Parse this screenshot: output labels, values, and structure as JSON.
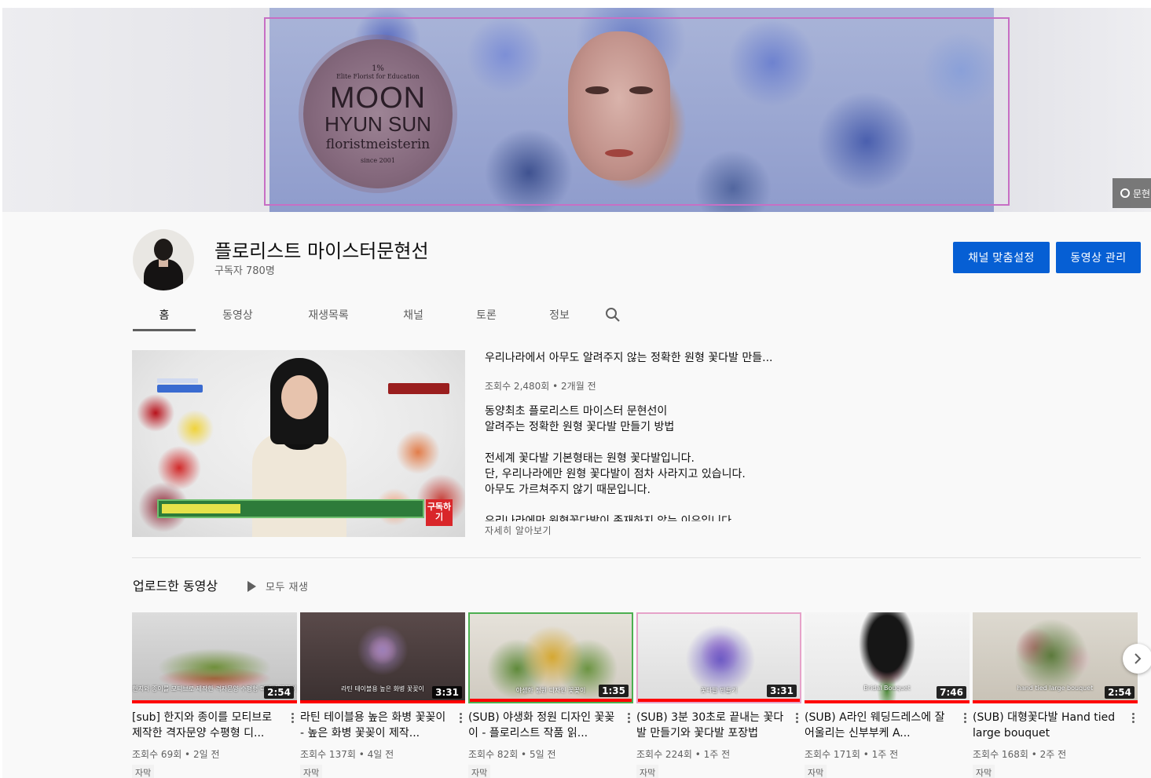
{
  "banner": {
    "seal_percent": "1%",
    "seal_tagline": "Elite Florist for Education",
    "seal_name_1": "MOON",
    "seal_name_2": "HYUN SUN",
    "seal_role": "floristmeisterin",
    "seal_since": "since 2001",
    "link_label": "문현"
  },
  "channel": {
    "name": "플로리스트 마이스터문현선",
    "subscribers": "구독자 780명",
    "customize_label": "채널 맞춤설정",
    "manage_label": "동영상 관리"
  },
  "tabs": [
    {
      "label": "홈",
      "active": true
    },
    {
      "label": "동영상"
    },
    {
      "label": "재생목록"
    },
    {
      "label": "채널"
    },
    {
      "label": "토론"
    },
    {
      "label": "정보"
    }
  ],
  "icons": {
    "search": "search-icon",
    "play": "play-icon",
    "more": "more-vert-icon",
    "next": "chevron-right-icon"
  },
  "featured": {
    "thumb_badge": "구독하기",
    "title": "우리나라에서 아무도 알려주지 않는 정확한 원형 꽃다발 만들...",
    "meta": "조회수 2,480회 • 2개월 전",
    "desc": [
      "동양최초 플로리스트 마이스터 문현선이",
      "알려주는 정확한 원형 꽃다발 만들기 방법",
      "",
      "전세계 꽃다발 기본형태는 원형 꽃다발입니다.",
      "단, 우리나라에만 원형 꽃다발이 점차 사라지고 있습니다.",
      "아무도 가르쳐주지 않기 때문입니다.",
      "",
      "우리나라에만 원형꽃다발이 존재하지 않는 이유입니다"
    ],
    "more_label": "자세히 알아보기"
  },
  "shelf": {
    "title": "업로드한 동영상",
    "play_all": "모두 재생",
    "videos": [
      {
        "title": "[sub] 한지와 종이를 모티브로 제작한 격자문양 수평형 디...",
        "duration": "2:54",
        "meta": "조회수 69회 • 2일 전",
        "badge": "자막",
        "caption": "한지와 종이를 모티브로 제작한 격자문양 수평형 디자인 꽃꽂이"
      },
      {
        "title": "라틴 테이블용 높은 화병 꽃꽂이 - 높은 화병 꽃꽂이 제작...",
        "duration": "3:31",
        "meta": "조회수 137회 • 4일 전",
        "badge": "자막",
        "caption": "라틴 테이블용 높은 화병 꽃꽂이"
      },
      {
        "title": "(SUB) 야생화 정원 디자인 꽃꽂이 - 플로리스트 작품 읽...",
        "duration": "1:35",
        "meta": "조회수 82회 • 5일 전",
        "badge": "자막",
        "caption": "야생화 정원 디자인 꽃꽂이"
      },
      {
        "title": "(SUB) 3분 30초로 끝내는 꽃다발 만들기와 꽃다발 포장법",
        "duration": "3:31",
        "meta": "조회수 224회 • 1주 전",
        "badge": "자막",
        "caption": "꽃다발 만들기"
      },
      {
        "title": "(SUB) A라인 웨딩드레스에 잘 어울리는 신부부케 A...",
        "duration": "7:46",
        "meta": "조회수 171회 • 1주 전",
        "badge": "자막",
        "caption": "Bridal Bouquet"
      },
      {
        "title": "(SUB) 대형꽃다발 Hand tied large bouquet",
        "duration": "2:54",
        "meta": "조회수 168회 • 2주 전",
        "badge": "자막",
        "caption": "hand tied large bouquet"
      }
    ]
  }
}
